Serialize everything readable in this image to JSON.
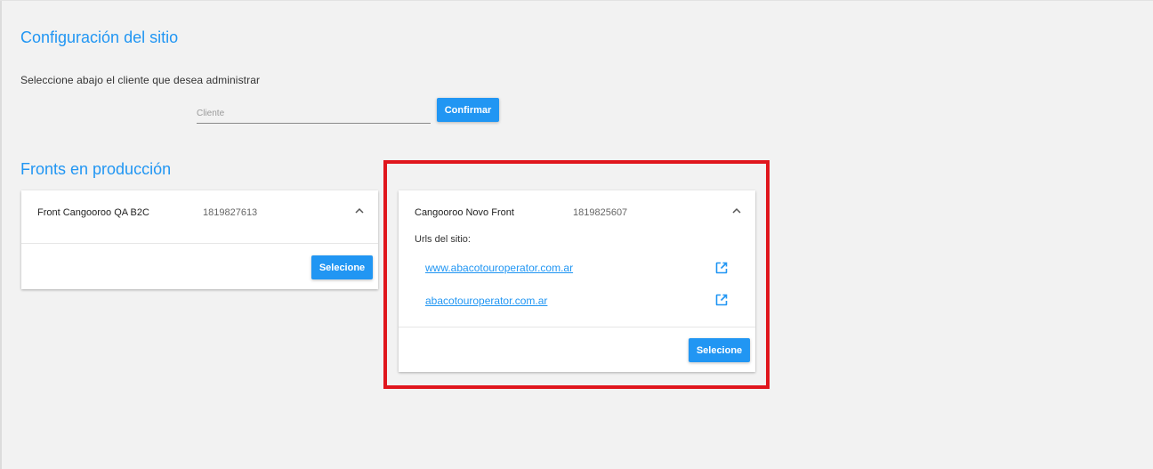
{
  "header": {
    "title": "Configuración del sitio",
    "instruction": "Seleccione abajo el cliente que desea administrar"
  },
  "client_search": {
    "placeholder": "Cliente",
    "value": "",
    "confirm_label": "Confirmar"
  },
  "fronts": {
    "section_title": "Fronts en producción",
    "cards": [
      {
        "name": "Front Cangooroo QA B2C",
        "id": "1819827613",
        "expanded": false,
        "select_label": "Selecione"
      },
      {
        "name": "Cangooroo Novo Front",
        "id": "1819825607",
        "expanded": true,
        "urls_label": "Urls del sitio:",
        "urls": [
          "www.abacotouroperator.com.ar",
          "abacotouroperator.com.ar"
        ],
        "select_label": "Selecione"
      }
    ]
  },
  "annotation": {
    "highlight_color": "#e0161d"
  },
  "colors": {
    "accent": "#2196f3",
    "background": "#f2f2f2"
  },
  "icons": {
    "collapse": "chevron-up-icon",
    "open_external": "open-in-new-icon"
  }
}
